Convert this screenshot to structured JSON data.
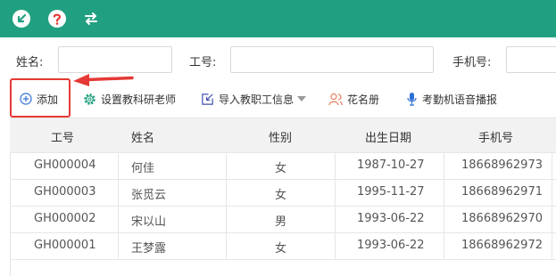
{
  "colors": {
    "topbar": "#21a081",
    "highlight": "#e53935",
    "accent": "#2e6fd6"
  },
  "topbar": {
    "icons": [
      "arrow-down-left-icon",
      "help-icon",
      "swap-icon"
    ]
  },
  "filters": [
    {
      "label": "姓名:",
      "value": "",
      "placeholder": ""
    },
    {
      "label": "工号:",
      "value": "",
      "placeholder": ""
    },
    {
      "label": "手机号:",
      "value": "",
      "placeholder": ""
    }
  ],
  "toolbar": {
    "add": "添加",
    "set_teacher": "设置教科研老师",
    "import": "导入教职工信息",
    "roster": "花名册",
    "voice": "考勤机语音播报"
  },
  "table": {
    "columns": [
      "工号",
      "姓名",
      "性别",
      "出生日期",
      "手机号"
    ],
    "rows": [
      [
        "GH000004",
        "何佳",
        "女",
        "1987-10-27",
        "18668962973"
      ],
      [
        "GH000003",
        "张觅云",
        "女",
        "1995-11-27",
        "18668962971"
      ],
      [
        "GH000002",
        "宋以山",
        "男",
        "1993-06-22",
        "18668962970"
      ],
      [
        "GH000001",
        "王梦露",
        "女",
        "1993-06-22",
        "18668962972"
      ]
    ]
  }
}
